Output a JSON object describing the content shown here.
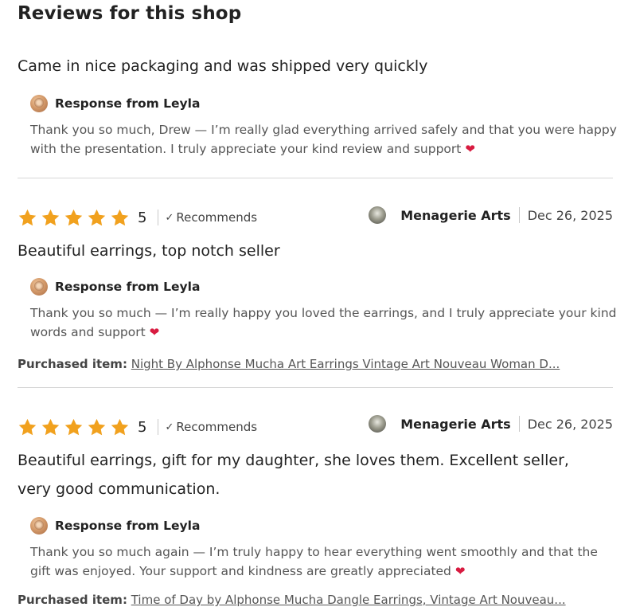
{
  "page": {
    "title": "Reviews for this shop"
  },
  "reviews": [
    {
      "text": "Came in nice packaging and was shipped very quickly",
      "response": {
        "heading": "Response from Leyla",
        "text": "Thank you so much, Drew — I’m really glad everything arrived safely and that you were happy with the presentation. I truly appreciate your kind review and support"
      }
    },
    {
      "rating": "5",
      "stars": 5,
      "recommends": "Recommends",
      "reviewer": "Menagerie Arts",
      "date": "Dec 26, 2025",
      "text": "Beautiful earrings, top notch seller",
      "response": {
        "heading": "Response from Leyla",
        "text": "Thank you so much — I’m really happy you loved the earrings, and I truly appreciate your kind words and support"
      },
      "purchased_label": "Purchased item:",
      "purchased_item": "Night By Alphonse Mucha Art Earrings Vintage Art Nouveau Woman D..."
    },
    {
      "rating": "5",
      "stars": 5,
      "recommends": "Recommends",
      "reviewer": "Menagerie Arts",
      "date": "Dec 26, 2025",
      "text": "Beautiful earrings, gift for my daughter, she loves them. Excellent seller, very good communication.",
      "response": {
        "heading": "Response from Leyla",
        "text": "Thank you so much again — I’m truly happy to hear everything went smoothly and that the gift was enjoyed. Your support and kindness are greatly appreciated"
      },
      "purchased_label": "Purchased item:",
      "purchased_item": "Time of Day by Alphonse Mucha Dangle Earrings, Vintage Art Nouveau..."
    }
  ],
  "colors": {
    "star": "#F1A11E",
    "heart": "#D81B40",
    "divider": "#D6D6D6"
  },
  "icons": {
    "star": "star-icon",
    "check": "check-icon",
    "heart": "heart-icon"
  }
}
